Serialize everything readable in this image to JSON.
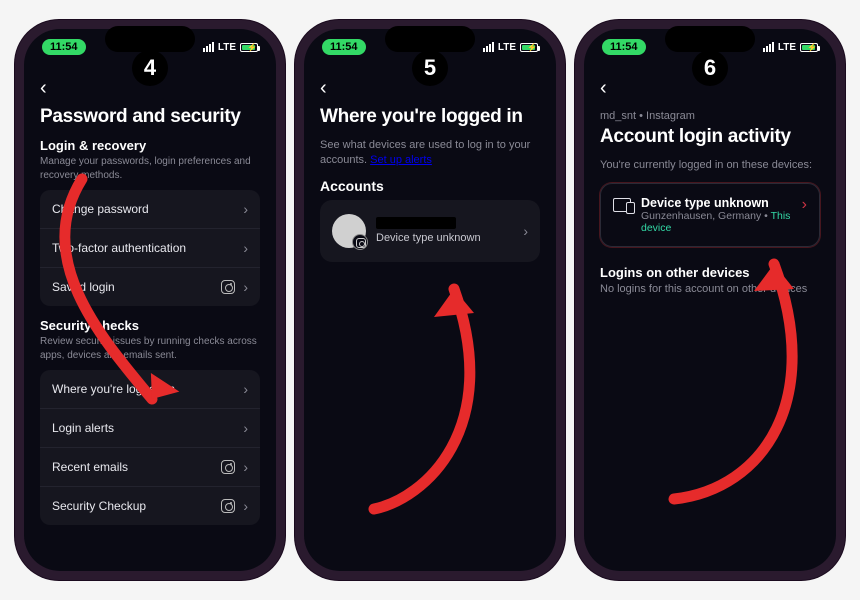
{
  "status": {
    "time": "11:54",
    "network": "LTE"
  },
  "steps": [
    "4",
    "5",
    "6"
  ],
  "screen4": {
    "title": "Password and security",
    "section1_title": "Login & recovery",
    "section1_sub": "Manage your passwords, login preferences and recovery methods.",
    "rows1": {
      "change_password": "Change password",
      "two_factor": "Two-factor authentication",
      "saved_login": "Saved login"
    },
    "section2_title": "Security checks",
    "section2_sub": "Review security issues by running checks across apps, devices and emails sent.",
    "rows2": {
      "where_logged_in": "Where you're logged in",
      "login_alerts": "Login alerts",
      "recent_emails": "Recent emails",
      "security_checkup": "Security Checkup"
    }
  },
  "screen5": {
    "title": "Where you're logged in",
    "subtitle_a": "See what devices are used to log in to your accounts. ",
    "subtitle_link": "Set up alerts",
    "accounts_header": "Accounts",
    "device_line": "Device type unknown"
  },
  "screen6": {
    "breadcrumb": "md_snt • Instagram",
    "title": "Account login activity",
    "subtitle": "You're currently logged in on these devices:",
    "device_title": "Device type unknown",
    "device_location": "Gunzenhausen, Germany • ",
    "device_this": "This device",
    "other_title": "Logins on other devices",
    "other_sub": "No logins for this account on other devices"
  }
}
